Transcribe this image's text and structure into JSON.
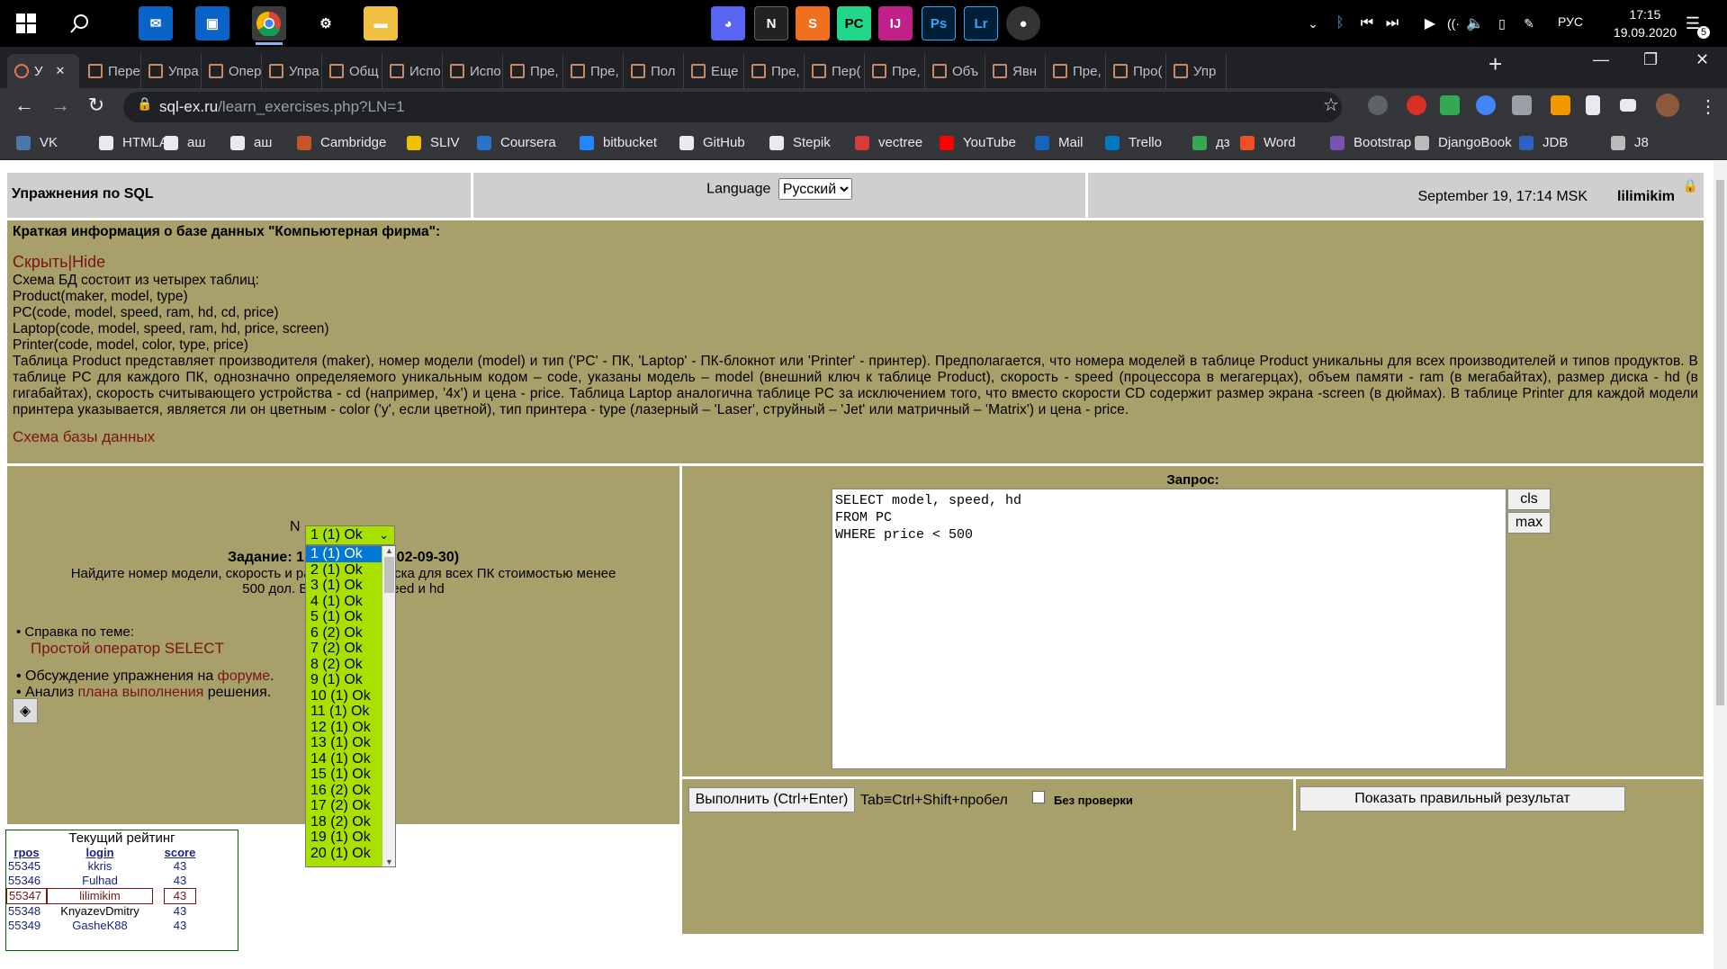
{
  "taskbar": {
    "clock_time": "17:15",
    "clock_date": "19.09.2020",
    "language": "РУС",
    "notifications": "5"
  },
  "tabs": [
    {
      "label": "У"
    },
    {
      "label": "Пере"
    },
    {
      "label": "Упра"
    },
    {
      "label": "Опер"
    },
    {
      "label": "Упра"
    },
    {
      "label": "Общ"
    },
    {
      "label": "Испо"
    },
    {
      "label": "Испо"
    },
    {
      "label": "Пре,"
    },
    {
      "label": "Пре,"
    },
    {
      "label": "Пол"
    },
    {
      "label": "Еще"
    },
    {
      "label": "Пре,"
    },
    {
      "label": "Пер("
    },
    {
      "label": "Пре,"
    },
    {
      "label": "Объ"
    },
    {
      "label": "Явн"
    },
    {
      "label": "Пре,"
    },
    {
      "label": "Про("
    },
    {
      "label": "Упр"
    }
  ],
  "address": {
    "host": "sql-ex.ru",
    "path": "/learn_exercises.php?LN=1"
  },
  "bookmarks": [
    {
      "label": "VK",
      "color": "#4a76a8"
    },
    {
      "label": "HTMLA",
      "color": "#e8eaed"
    },
    {
      "label": "аш",
      "color": "#e8eaed"
    },
    {
      "label": "аш",
      "color": "#e8eaed"
    },
    {
      "label": "Cambridge",
      "color": "#c5532c"
    },
    {
      "label": "SLIV",
      "color": "#f0c000"
    },
    {
      "label": "Coursera",
      "color": "#2a73cc"
    },
    {
      "label": "bitbucket",
      "color": "#2684ff"
    },
    {
      "label": "GitHub",
      "color": "#e8eaed"
    },
    {
      "label": "Stepik",
      "color": "#e8eaed"
    },
    {
      "label": "vectree",
      "color": "#d83b3b"
    },
    {
      "label": "YouTube",
      "color": "#ff0000"
    },
    {
      "label": "Mail",
      "color": "#1565c0"
    },
    {
      "label": "Trello",
      "color": "#0079bf"
    },
    {
      "label": "дз",
      "color": "#34a853"
    },
    {
      "label": "Word",
      "color": "#f25022"
    },
    {
      "label": "Bootstrap",
      "color": "#7952b3"
    },
    {
      "label": "DjangoBook",
      "color": "#bbbbbb"
    },
    {
      "label": "JDB",
      "color": "#3060c0"
    },
    {
      "label": "J8",
      "color": "#bbbbbb"
    }
  ],
  "header": {
    "title": "Упражнения по SQL",
    "language_label": "Language",
    "language_value": "Русский",
    "datetime": "September 19, 17:14 MSK",
    "user": "lilimikim"
  },
  "info": {
    "title": "Краткая информация о базе данных \"Компьютерная фирма\":",
    "hide_link": "Скрыть|Hide",
    "lines": [
      "Схема БД состоит из четырех таблиц:",
      "Product(maker, model, type)",
      "PC(code, model, speed, ram, hd, cd, price)",
      "Laptop(code, model, speed, ram, hd, price, screen)",
      "Printer(code, model, color, type, price)"
    ],
    "description": "Таблица Product представляет производителя (maker), номер модели (model) и тип ('PC' - ПК, 'Laptop' - ПК-блокнот или 'Printer' - принтер). Предполагается, что номера моделей в таблице Product уникальны для всех производителей и типов продуктов. В таблице PC для каждого ПК, однозначно определяемого уникальным кодом – code, указаны модель – model (внешний ключ к таблице Product), скорость - speed (процессора в мегагерцах), объем памяти - ram (в мегабайтах), размер диска - hd (в гигабайтах), скорость считывающего устройства - cd (например, '4x') и цена - price. Таблица Laptop аналогична таблице PC за исключением того, что вместо скорости CD содержит размер экрана -screen (в дюймах). В таблице Printer для каждой модели принтера указывается, является ли он цветным - color ('y', если цветной), тип принтера - type (лазерный – 'Laser', струйный – 'Jet' или матричный – 'Matrix') и цена - price.",
    "schema_link": "Схема базы данных"
  },
  "task": {
    "n_label": "N",
    "selected": "1 (1) Ok",
    "title_start": "Задание: 1 (",
    "title_end": "02-09-30)",
    "text_line1_a": "Найдите номер модели, скорость и разм",
    "text_line1_b": "диска для всех ПК стоимостью менее",
    "text_line2_a": "500 дол. Выв",
    "text_line2_b": "speed и hd",
    "help_label": "• Справка по теме:",
    "help_link": "Простой оператор SELECT",
    "discuss_prefix": "• Обсуждение упражнения на ",
    "discuss_link": "форуме",
    "discuss_suffix": ".",
    "analysis_prefix": "• Анализ ",
    "analysis_link": "плана выполнения",
    "analysis_suffix": " решения."
  },
  "dropdown_options": [
    "1 (1) Ok",
    "2 (1) Ok",
    "3 (1) Ok",
    "4 (1) Ok",
    "5 (1) Ok",
    "6 (2) Ok",
    "7 (2) Ok",
    "8 (2) Ok",
    "9 (1) Ok",
    "10 (1) Ok",
    "11 (1) Ok",
    "12 (1) Ok",
    "13 (1) Ok",
    "14 (1) Ok",
    "15 (1) Ok",
    "16 (2) Ok",
    "17 (2) Ok",
    "18 (2) Ok",
    "19 (1) Ok",
    "20 (1) Ok"
  ],
  "query": {
    "label": "Запрос:",
    "text": "SELECT model, speed, hd\nFROM PC\nWHERE price < 500",
    "cls": "cls",
    "max": "max",
    "run": "Выполнить (Ctrl+Enter)",
    "tab_hint": "Tab≡Ctrl+Shift+пробел",
    "nocheck": "Без проверки",
    "show_result": "Показать правильный результат"
  },
  "rating": {
    "title": "Текущий рейтинг",
    "cols": [
      "rpos",
      "login",
      "score"
    ],
    "rows": [
      [
        "55345",
        "kkris",
        "43"
      ],
      [
        "55346",
        "Fulhad",
        "43"
      ],
      [
        "55347",
        "lilimikim",
        "43"
      ],
      [
        "55348",
        "KnyazevDmitry",
        "43"
      ],
      [
        "55349",
        "GasheK88",
        "43"
      ]
    ]
  }
}
